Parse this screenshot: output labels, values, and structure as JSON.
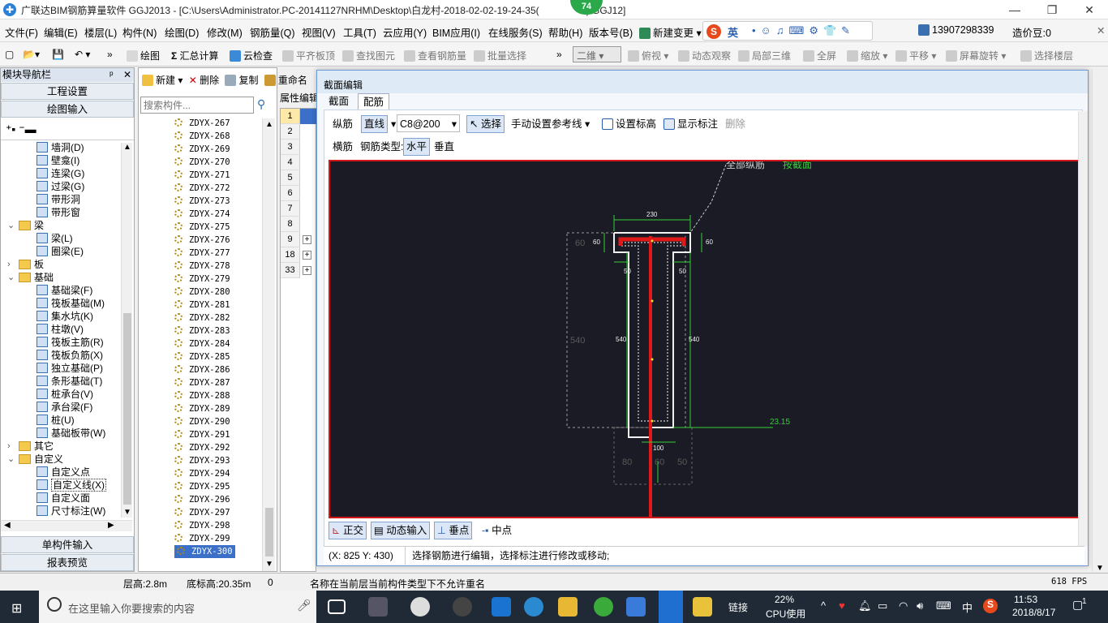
{
  "titlebar": {
    "title": "广联达BIM钢筋算量软件 GGJ2013 - [C:\\Users\\Administrator.PC-20141127NRHM\\Desktop\\白龙村-2018-02-02-19-24-35(",
    "title_suffix": ").GGJ12]",
    "badge": "74"
  },
  "menubar": {
    "items": [
      "文件(F)",
      "编辑(E)",
      "楼层(L)",
      "构件(N)",
      "绘图(D)",
      "修改(M)",
      "钢筋量(Q)",
      "视图(V)",
      "工具(T)",
      "云应用(Y)",
      "BIM应用(I)",
      "在线服务(S)",
      "帮助(H)",
      "版本号(B)",
      "新建变更"
    ],
    "ime_label": "英",
    "phone": "13907298339",
    "price_bean": "造价豆:0"
  },
  "toolbar": {
    "items": [
      "绘图",
      "汇总计算",
      "云检查",
      "平齐板顶",
      "查找图元",
      "查看钢筋量",
      "批量选择"
    ],
    "view_mode": "二维",
    "right_items": [
      "俯视",
      "动态观察",
      "局部三维",
      "全屏",
      "缩放",
      "平移",
      "屏幕旋转",
      "选择楼层"
    ]
  },
  "nav": {
    "title": "模块导航栏",
    "engineering_settings": "工程设置",
    "drawing_input": "绘图输入",
    "tree": [
      {
        "label": "墙洞(D)",
        "indent": 2
      },
      {
        "label": "壁龛(I)",
        "indent": 2
      },
      {
        "label": "连梁(G)",
        "indent": 2
      },
      {
        "label": "过梁(G)",
        "indent": 2
      },
      {
        "label": "带形洞",
        "indent": 2
      },
      {
        "label": "带形窗",
        "indent": 2
      },
      {
        "label": "梁",
        "indent": 1,
        "folder": true,
        "expanded": true
      },
      {
        "label": "梁(L)",
        "indent": 2
      },
      {
        "label": "圈梁(E)",
        "indent": 2
      },
      {
        "label": "板",
        "indent": 1,
        "folder": true,
        "expanded": false
      },
      {
        "label": "基础",
        "indent": 1,
        "folder": true,
        "expanded": true
      },
      {
        "label": "基础梁(F)",
        "indent": 2
      },
      {
        "label": "筏板基础(M)",
        "indent": 2
      },
      {
        "label": "集水坑(K)",
        "indent": 2
      },
      {
        "label": "柱墩(V)",
        "indent": 2
      },
      {
        "label": "筏板主筋(R)",
        "indent": 2
      },
      {
        "label": "筏板负筋(X)",
        "indent": 2
      },
      {
        "label": "独立基础(P)",
        "indent": 2
      },
      {
        "label": "条形基础(T)",
        "indent": 2
      },
      {
        "label": "桩承台(V)",
        "indent": 2
      },
      {
        "label": "承台梁(F)",
        "indent": 2
      },
      {
        "label": "桩(U)",
        "indent": 2
      },
      {
        "label": "基础板带(W)",
        "indent": 2
      },
      {
        "label": "其它",
        "indent": 1,
        "folder": true,
        "expanded": false
      },
      {
        "label": "自定义",
        "indent": 1,
        "folder": true,
        "expanded": true
      },
      {
        "label": "自定义点",
        "indent": 2
      },
      {
        "label": "自定义线(X)",
        "indent": 2,
        "selected": true
      },
      {
        "label": "自定义面",
        "indent": 2
      },
      {
        "label": "尺寸标注(W)",
        "indent": 2
      }
    ],
    "single_input": "单构件输入",
    "report_preview": "报表预览"
  },
  "complist": {
    "toolbar": [
      "新建",
      "删除",
      "复制",
      "重命名"
    ],
    "search_placeholder": "搜索构件...",
    "items": [
      "ZDYX-267",
      "ZDYX-268",
      "ZDYX-269",
      "ZDYX-270",
      "ZDYX-271",
      "ZDYX-272",
      "ZDYX-273",
      "ZDYX-274",
      "ZDYX-275",
      "ZDYX-276",
      "ZDYX-277",
      "ZDYX-278",
      "ZDYX-279",
      "ZDYX-280",
      "ZDYX-281",
      "ZDYX-282",
      "ZDYX-283",
      "ZDYX-284",
      "ZDYX-285",
      "ZDYX-286",
      "ZDYX-287",
      "ZDYX-288",
      "ZDYX-289",
      "ZDYX-290",
      "ZDYX-291",
      "ZDYX-292",
      "ZDYX-293",
      "ZDYX-294",
      "ZDYX-295",
      "ZDYX-296",
      "ZDYX-297",
      "ZDYX-298",
      "ZDYX-299",
      "ZDYX-300"
    ],
    "selected": "ZDYX-300"
  },
  "propgrid": {
    "title": "属性编辑",
    "rows": [
      "1",
      "2",
      "3",
      "4",
      "5",
      "6",
      "7",
      "8",
      "9",
      "18",
      "33"
    ]
  },
  "dialog": {
    "title": "截面编辑",
    "tabs": [
      "截面",
      "配筋"
    ],
    "active_tab": "配筋",
    "row1": {
      "label_longitudinal": "纵筋",
      "mode": "直线",
      "rebar_spec": "C8@200",
      "select": "选择",
      "manual_ref": "手动设置参考线",
      "set_elevation": "设置标高",
      "show_annotation": "显示标注",
      "delete": "删除"
    },
    "row2": {
      "transverse": "横筋",
      "rebar_type_label": "钢筋类型:",
      "horizontal": "水平",
      "vertical": "垂直"
    },
    "canvas_texts": {
      "all_longitudinal": "全部纵筋",
      "by_section": "按截面",
      "dim_230": "230",
      "dim_60a": "60",
      "dim_60b": "60",
      "dim_60c": "60",
      "dim_50a": "50",
      "dim_50b": "50",
      "dim_540a": "540",
      "dim_540b": "540",
      "dim_540c": "540",
      "dim_100": "100",
      "dim_80": "80",
      "dim_60d": "60",
      "dim_50c": "50",
      "elev": "23.15"
    },
    "bottom_bar": [
      "正交",
      "动态输入",
      "垂点",
      "中点"
    ],
    "coords": "(X: 825 Y: 430)",
    "hint": "选择钢筋进行编辑，选择标注进行修改或移动;"
  },
  "statusbar": {
    "floor_height": "层高:2.8m",
    "bottom_elev": "底标高:20.35m",
    "zero": "0",
    "message": "名称在当前层当前构件类型下不允许重名",
    "fps": "618 FPS"
  },
  "taskbar": {
    "search_placeholder": "在这里输入你要搜索的内容",
    "link": "链接",
    "cpu_percent": "22%",
    "cpu_label": "CPU使用",
    "lang": "中",
    "time": "11:53",
    "date": "2018/8/17",
    "notif": "1"
  },
  "colors": {
    "accent": "#3b6fc8",
    "canvas_bg": "#1a1b25",
    "canvas_border": "#d21818",
    "rebar_red": "#e01818",
    "dim_green": "#35d135"
  }
}
